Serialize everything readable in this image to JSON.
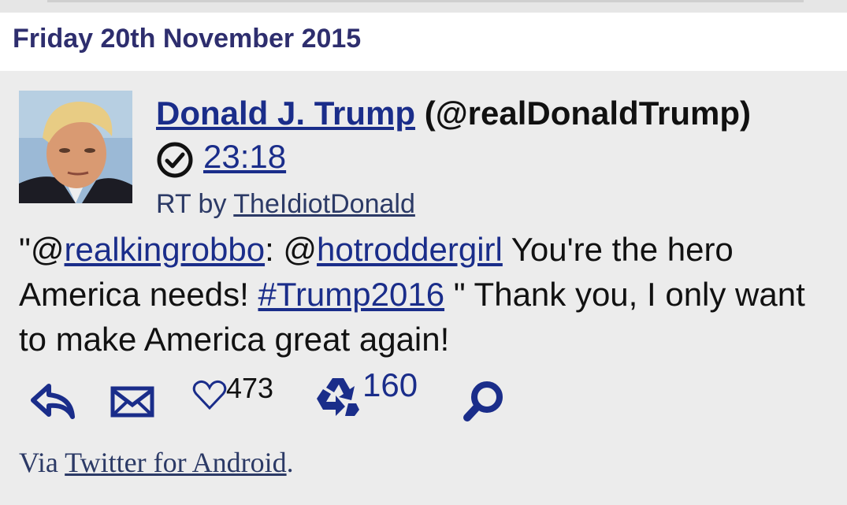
{
  "date_header": "Friday 20th November 2015",
  "tweet": {
    "author_name": "Donald J. Trump",
    "author_handle": "(@realDonaldTrump)",
    "time": "23:18",
    "rt_prefix": "RT by ",
    "rt_user": "TheIdiotDonald",
    "text": {
      "open_quote": "\"@",
      "mention1": "realkingrobbo",
      "sep": ": @",
      "mention2": "hotroddergirl",
      "part1": " You're the hero America needs! ",
      "hashtag": "#Trump2016",
      "part2": " \" Thank you, I only want to make America great again!"
    },
    "likes": "473",
    "retweets": "160",
    "via_prefix": "Via ",
    "via_source": "Twitter for Android",
    "via_suffix": "."
  },
  "icons": {
    "reply": "reply-icon",
    "message": "envelope-icon",
    "like": "heart-icon",
    "retweet": "recycle-icon",
    "search": "search-icon",
    "verified": "check-circle-icon"
  },
  "colors": {
    "link": "#1a2d8a",
    "date": "#2e2e6e",
    "background": "#ececec"
  }
}
